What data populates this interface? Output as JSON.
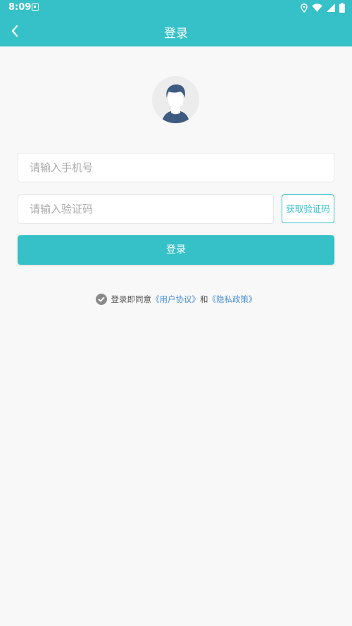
{
  "status_bar": {
    "time": "8:09",
    "icons": [
      "image-notification-icon",
      "location-icon",
      "wifi-icon",
      "signal-icon",
      "battery-icon"
    ]
  },
  "app_bar": {
    "back_icon": "chevron-left-icon",
    "title": "登录"
  },
  "avatar": {
    "icon": "user-avatar-icon"
  },
  "form": {
    "phone_placeholder": "请输入手机号",
    "code_placeholder": "请输入验证码",
    "get_code_label": "获取验证码",
    "login_label": "登录"
  },
  "agreement": {
    "checked": true,
    "prefix": "登录即同意",
    "user_agreement": "《用户协议》",
    "and": "和",
    "privacy_policy": "《隐私政策》"
  },
  "colors": {
    "primary": "#36c1c8",
    "background": "#f8f8f8",
    "link": "#4a90d9"
  }
}
